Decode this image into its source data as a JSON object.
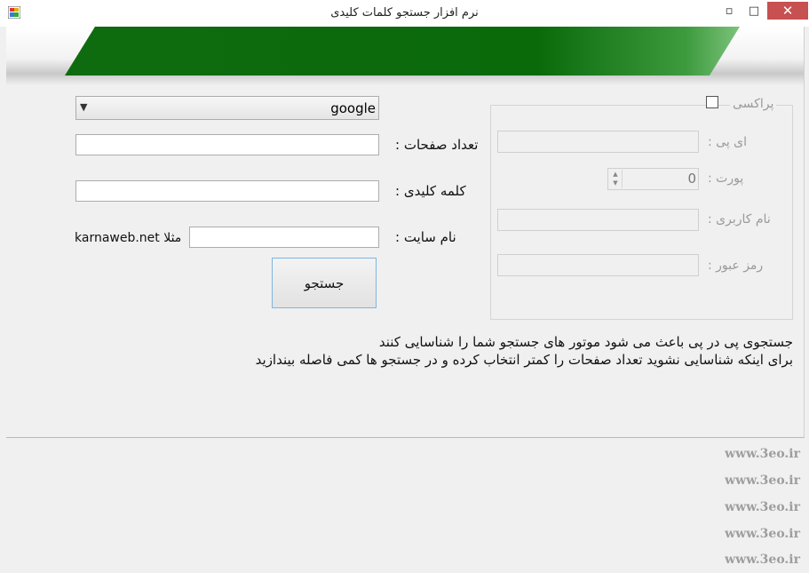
{
  "window": {
    "title": "نرم افزار جستجو کلمات کلیدی",
    "minimize_glyph": "▫",
    "maximize_glyph": "□",
    "close_glyph": "✕"
  },
  "form": {
    "engine_value": "google",
    "pages_label": "تعداد صفحات :",
    "keyword_label": "کلمه کلیدی :",
    "site_label": "نام سایت :",
    "site_example": "مثلا karnaweb.net",
    "search_button": "جستجو",
    "pages_value": "",
    "keyword_value": "",
    "site_value": ""
  },
  "proxy": {
    "legend": "پراکسی",
    "ip_label": "ای پی :",
    "port_label": "پورت :",
    "port_value": "0",
    "username_label": "نام کاربری :",
    "password_label": "رمز عبور :",
    "enabled": false
  },
  "notes": {
    "line1": "جستجوی پی در پی باعث می شود موتور های جستجو شما را شناسایی کنند",
    "line2": "برای اینکه شناسایی نشوید تعداد صفحات را کمتر انتخاب کرده و در جستجو ها کمی فاصله بیندازید"
  },
  "watermarks": [
    "www.3eo.ir",
    "www.3eo.ir",
    "www.3eo.ir",
    "www.3eo.ir",
    "www.3eo.ir"
  ],
  "colors": {
    "banner_green": "#0a6a0a",
    "close_button": "#c75050",
    "button_border": "#7fb5e0"
  }
}
